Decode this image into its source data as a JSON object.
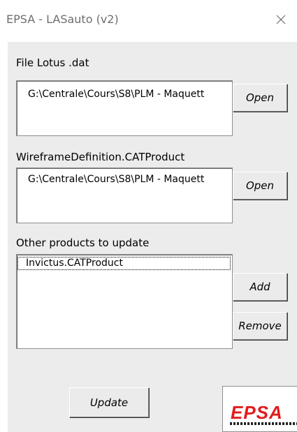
{
  "window": {
    "title": "EPSA - LASauto (v2)"
  },
  "lotus": {
    "label": "File Lotus .dat",
    "path": "G:\\Centrale\\Cours\\S8\\PLM - Maquett",
    "open_label": "Open"
  },
  "wireframe": {
    "label": "WireframeDefinition.CATProduct",
    "path": "G:\\Centrale\\Cours\\S8\\PLM - Maquett",
    "open_label": "Open"
  },
  "others": {
    "label": "Other products to update",
    "items": [
      "Invictus.CATProduct"
    ],
    "add_label": "Add",
    "remove_label": "Remove"
  },
  "update_label": "Update",
  "logo": {
    "text": "EPSA",
    "color": "#e21b1b"
  },
  "icons": {
    "close": "close-icon"
  }
}
